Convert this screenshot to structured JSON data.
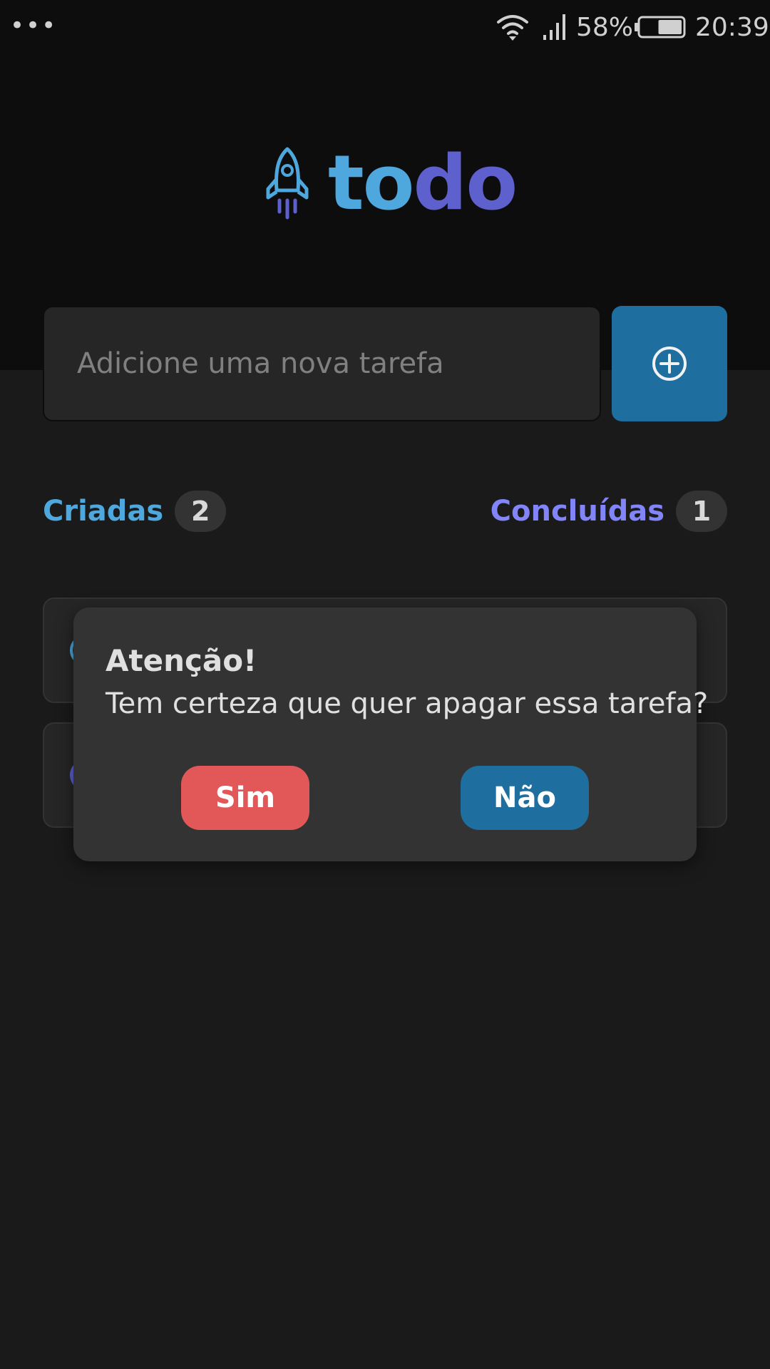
{
  "status_bar": {
    "menu_dots": "•••",
    "battery_percent": "58%",
    "time": "20:39",
    "battery_level": 0.58
  },
  "logo": {
    "text_part1": "to",
    "text_part2": "do",
    "icon": "rocket-icon"
  },
  "new_task": {
    "placeholder": "Adicione uma nova tarefa",
    "add_icon": "plus-circle-icon"
  },
  "counters": {
    "created_label": "Criadas",
    "created_count": "2",
    "done_label": "Concluídas",
    "done_count": "1"
  },
  "dialog": {
    "title": "Atenção!",
    "message": "Tem certeza que quer apagar essa tarefa?",
    "yes_label": "Sim",
    "no_label": "Não"
  },
  "colors": {
    "background": "#1a1a1a",
    "header": "#0d0d0d",
    "blue": "#4ea8de",
    "blue_dark": "#1e6f9f",
    "purple": "#8284fa",
    "purple_dark": "#5e60ce",
    "danger": "#e25858"
  }
}
